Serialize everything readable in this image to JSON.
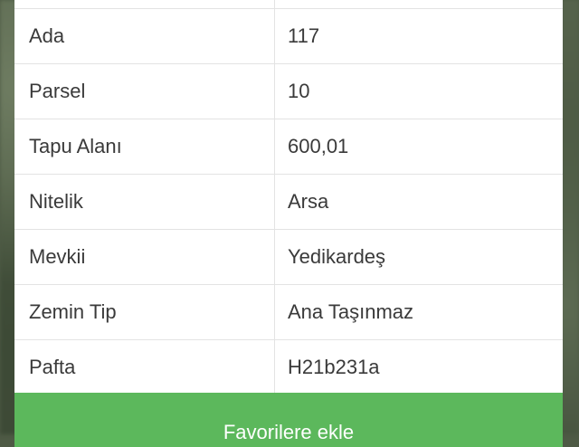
{
  "table": {
    "rows": [
      {
        "key": "",
        "value": ""
      },
      {
        "key": "Ada",
        "value": "117"
      },
      {
        "key": "Parsel",
        "value": "10"
      },
      {
        "key": "Tapu Alanı",
        "value": "600,01"
      },
      {
        "key": "Nitelik",
        "value": "Arsa"
      },
      {
        "key": "Mevkii",
        "value": "Yedikardeş"
      },
      {
        "key": "Zemin Tip",
        "value": "Ana Taşınmaz"
      },
      {
        "key": "Pafta",
        "value": "H21b231a"
      }
    ]
  },
  "actions": {
    "favorite_label": "Favorilere ekle"
  },
  "colors": {
    "button": "#5cb85c",
    "background_map": "#4e5a45"
  }
}
